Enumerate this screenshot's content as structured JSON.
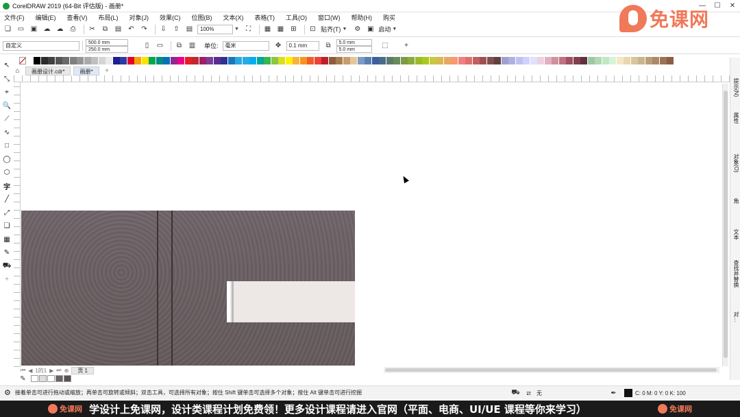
{
  "window": {
    "title": "CorelDRAW 2019 (64-Bit 评估版) - 画册*",
    "controls": [
      "—",
      "☐",
      "✕"
    ]
  },
  "watermark": {
    "brand": "免课网"
  },
  "menu": [
    "文件(F)",
    "编辑(E)",
    "查看(V)",
    "布局(L)",
    "对象(J)",
    "效果(C)",
    "位图(B)",
    "文本(X)",
    "表格(T)",
    "工具(O)",
    "窗口(W)",
    "帮助(H)",
    "购买"
  ],
  "toolbar1": {
    "zoom": "100%",
    "snap_label": "贴齐(T)",
    "launch_label": "启动"
  },
  "toolbar2": {
    "preset": "自定义",
    "width": "500.0 mm",
    "height": "250.0 mm",
    "unit_label": "单位:",
    "unit": "毫米",
    "nudge": "0.1 mm",
    "dup_x": "5.0 mm",
    "dup_y": "5.0 mm"
  },
  "palette": {
    "colors": [
      "#ffffff",
      "#000000",
      "#2b2b2b",
      "#404040",
      "#555555",
      "#6a6a6a",
      "#808080",
      "#959595",
      "#aaaaaa",
      "#c0c0c0",
      "#d5d5d5",
      "#ebebeb",
      "#1b1f8f",
      "#2b3aa8",
      "#e4002b",
      "#f5a300",
      "#ffe100",
      "#00a650",
      "#008d7f",
      "#0072bc",
      "#92278f",
      "#ec008c",
      "#e31e24",
      "#c1272d",
      "#9e1f63",
      "#7b3f99",
      "#5c2d91",
      "#2e3192",
      "#1c75bc",
      "#27aae1",
      "#29abe2",
      "#00aeef",
      "#00a79d",
      "#39b54a",
      "#8dc63f",
      "#d7df23",
      "#fff200",
      "#fbb040",
      "#f7941d",
      "#f15a29",
      "#ef4136",
      "#be1e2d",
      "#8b5e3c",
      "#a97c50",
      "#c69c6d",
      "#e6c79c",
      "#7a9cc6",
      "#5b7fb2",
      "#3d5f9e",
      "#4a6a8a",
      "#5a7a6a",
      "#6a8a5a",
      "#7a9a4a",
      "#8aaa3a",
      "#9aba2a",
      "#aaca1a",
      "#c8c840",
      "#d8b850",
      "#e8a860",
      "#f89870",
      "#f08080",
      "#e07070",
      "#c06060",
      "#a05050",
      "#805050",
      "#604040",
      "#a0a0d0",
      "#b0b0e0",
      "#c0c0f0",
      "#d0d0ff",
      "#e0e0ff",
      "#f0d0e0",
      "#e0b0c0",
      "#d090a0",
      "#c07080",
      "#a05060",
      "#804050",
      "#603040",
      "#9ec9a0",
      "#b0d8b2",
      "#c2e7c4",
      "#d4f6d6",
      "#f6e7c4",
      "#e7d6b0",
      "#d8c59e",
      "#c9b48c",
      "#ba9e7a",
      "#ab8868",
      "#9c7256",
      "#8d5c44"
    ]
  },
  "tabs": [
    {
      "label": "画册设计.cdr*"
    },
    {
      "label": "画册*"
    }
  ],
  "tools": [
    "↖",
    "⤡",
    "⌖",
    "🔍",
    "⟋",
    "∿",
    "□",
    "◯",
    "⬡",
    "字",
    "╱",
    "⤢",
    "❏",
    "▦",
    "✎",
    "⛟",
    "+"
  ],
  "right_dock": [
    "提示(N)",
    "属性",
    "对象(O)",
    "角",
    "文本",
    "查找并替换",
    "对…"
  ],
  "pagebar": {
    "counter": "1的1",
    "page_label": "页 1"
  },
  "statusbar": {
    "hint": "接着单击可进行拖动或缩放；再单击可旋转或倾斜；双击工具，可选择所有对象；按住 Shift 键单击可选择多个对象；按住 Alt 键单击可进行挖掘",
    "fill_label": "无",
    "cmyk": "C: 0 M: 0 Y: 0 K: 100"
  },
  "banner": {
    "brand": "免课网",
    "text": "学设计上免课网，设计类课程计划免费领！更多设计课程请进入官网（平面、电商、UI/UE 课程等你来学习）"
  }
}
